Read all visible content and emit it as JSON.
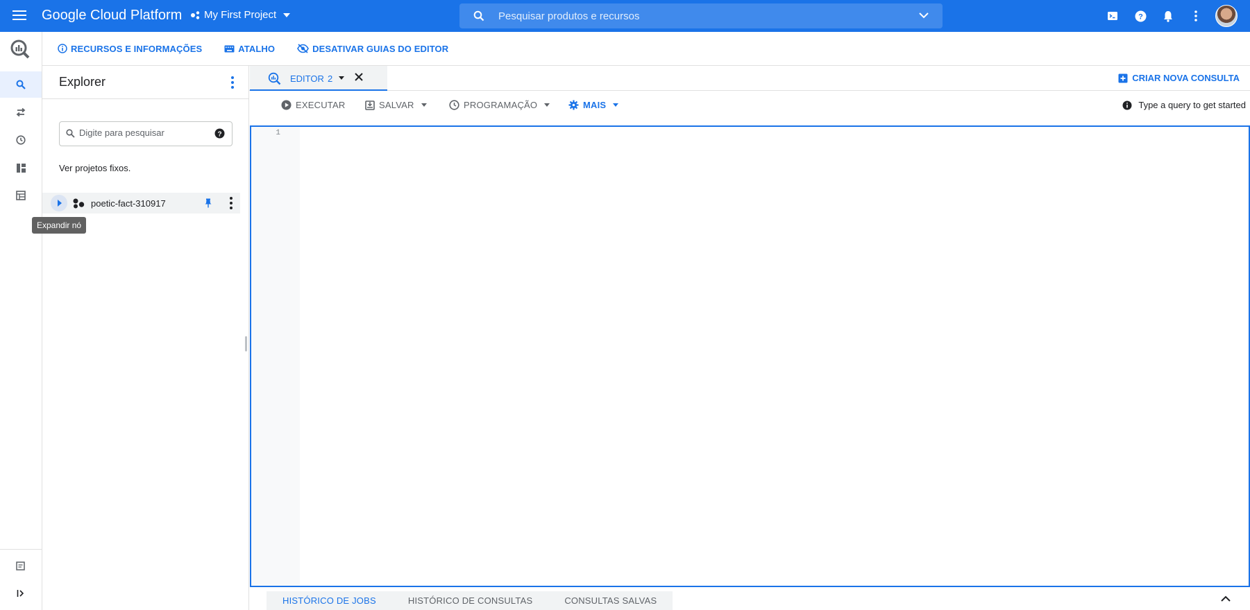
{
  "topbar": {
    "brand": "Google Cloud Platform",
    "project": "My First Project",
    "search_placeholder": "Pesquisar produtos e recursos"
  },
  "subheader": {
    "resources": "RECURSOS E INFORMAÇÕES",
    "shortcut": "ATALHO",
    "disable_guides": "DESATIVAR GUIAS DO EDITOR"
  },
  "explorer": {
    "title": "Explorer",
    "search_placeholder": "Digite para pesquisar",
    "pinned_text": "Ver projetos fixos.",
    "project_name": "poetic-fact-310917",
    "tooltip": "Expandir nó"
  },
  "editor": {
    "tab_label": "EDITOR",
    "tab_number": "2",
    "new_query": "CRIAR NOVA CONSULTA",
    "toolbar": {
      "run": "EXECUTAR",
      "save": "SALVAR",
      "schedule": "PROGRAMAÇÃO",
      "more": "MAIS"
    },
    "hint": "Type a query to get started",
    "line_number": "1"
  },
  "bottom_tabs": {
    "jobs": "HISTÓRICO DE JOBS",
    "queries": "HISTÓRICO DE CONSULTAS",
    "saved": "CONSULTAS SALVAS"
  },
  "colors": {
    "brand_blue": "#1a73e8",
    "panel_gray": "#f1f3f4"
  }
}
